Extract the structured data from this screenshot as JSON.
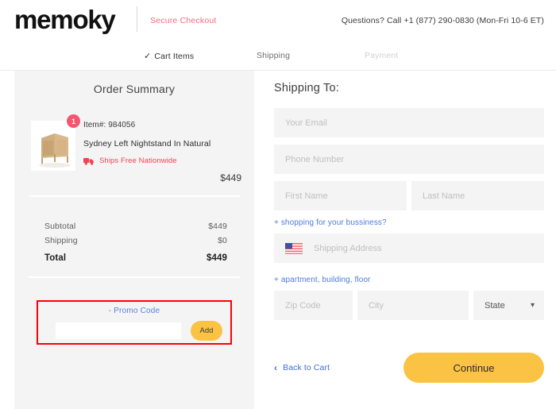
{
  "header": {
    "logo_text": "memoky",
    "secure_checkout": "Secure Checkout",
    "questions": "Questions? Call +1 (877) 290-0830 (Mon-Fri 10-6 ET)"
  },
  "tabs": [
    {
      "label": "Cart Items",
      "check": "✓",
      "state": "completed"
    },
    {
      "label": "Shipping",
      "state": "current"
    },
    {
      "label": "Payment",
      "state": "upcoming"
    }
  ],
  "order_summary": {
    "title": "Order Summary",
    "item": {
      "quantity_badge": "1",
      "item_number_label": "Item#: 984056",
      "name": "Sydney Left Nightstand In Natural",
      "shipping_note": "Ships Free Nationwide",
      "price": "$449"
    },
    "totals": [
      {
        "label": "Subtotal",
        "value": "$449"
      },
      {
        "label": "Shipping",
        "value": "$0"
      }
    ],
    "grand_total": {
      "label": "Total",
      "value": "$449"
    },
    "promo": {
      "toggle_label": "-  Promo Code",
      "input_value": "",
      "input_placeholder": "",
      "add_button": "Add"
    }
  },
  "shipping_form": {
    "title": "Shipping To:",
    "email_placeholder": "Your Email",
    "phone_placeholder": "Phone Number",
    "first_name_placeholder": "First Name",
    "last_name_placeholder": "Last Name",
    "business_link": "+ shopping for your bussiness?",
    "address_placeholder": "Shipping Address",
    "apartment_link": "+ apartment, building, floor",
    "zip_placeholder": "Zip Code",
    "city_placeholder": "City",
    "state_value": "State",
    "back_to_cart": "Back to Cart",
    "continue_button": "Continue"
  },
  "colors": {
    "accent_yellow": "#FBC343",
    "accent_pink": "#F5566F",
    "link_blue": "#4F7BDB",
    "panel_gray": "#F4F4F4",
    "highlight_red": "#FF0000"
  }
}
